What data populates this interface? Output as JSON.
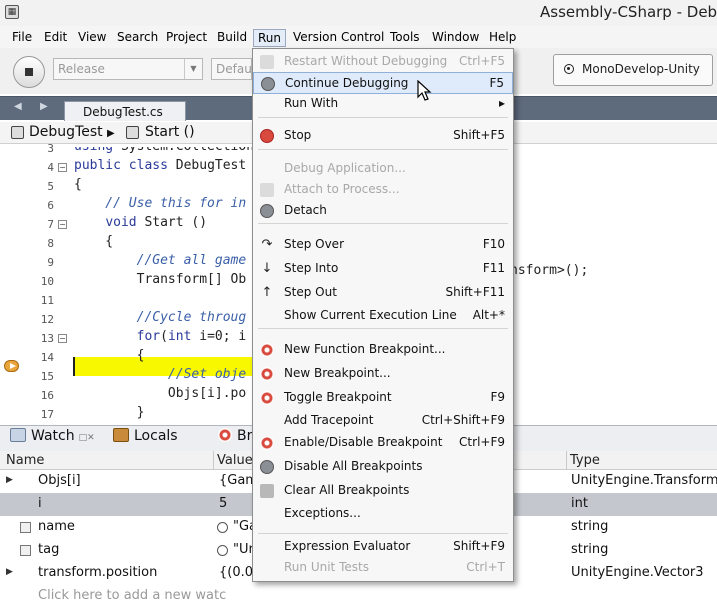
{
  "window": {
    "title": "Assembly-CSharp - Debug"
  },
  "menubar": {
    "items": [
      "File",
      "Edit",
      "View",
      "Search",
      "Project",
      "Build",
      "Run",
      "Version Control",
      "Tools",
      "Window",
      "Help"
    ],
    "active": "Run"
  },
  "toolbar": {
    "config_value": "Release",
    "platform_value": "Default",
    "target_label": "MonoDevelop-Unity"
  },
  "editor": {
    "tab_label": "DebugTest.cs",
    "path_class": "DebugTest",
    "path_method": "Start ()",
    "lines": [
      {
        "n": "3",
        "text": "using System.Collections"
      },
      {
        "n": "4",
        "text": "public class DebugTest"
      },
      {
        "n": "5",
        "text": "{"
      },
      {
        "n": "6",
        "text": "    // Use this for in"
      },
      {
        "n": "7",
        "text": "    void Start ()"
      },
      {
        "n": "8",
        "text": "    {"
      },
      {
        "n": "9",
        "text": "        //Get all game"
      },
      {
        "n": "10",
        "text": "        Transform[] Ob"
      },
      {
        "n": "11",
        "text": ""
      },
      {
        "n": "12",
        "text": "        //Cycle throug"
      },
      {
        "n": "13",
        "text": "        for(int i=0; i"
      },
      {
        "n": "14",
        "text": "        {"
      },
      {
        "n": "15",
        "text": "            //Set obje"
      },
      {
        "n": "16",
        "text": "            Objs[i].po"
      },
      {
        "n": "17",
        "text": "        }"
      },
      {
        "n": "18",
        "text": "    }"
      },
      {
        "n": "19",
        "text": "}"
      }
    ],
    "tail_text": "nsform>();",
    "current_line": "16"
  },
  "pads": {
    "tabs": [
      "Watch",
      "Locals",
      "Br"
    ]
  },
  "watch": {
    "columns": [
      "Name",
      "Value",
      "Type"
    ],
    "rows": [
      {
        "name": "Objs[i]",
        "value": "{Gam",
        "type": "UnityEngine.Transform",
        "expandable": true,
        "selected": false,
        "icon": "none"
      },
      {
        "name": "i",
        "value": "5",
        "type": "int",
        "expandable": false,
        "selected": true,
        "icon": "none"
      },
      {
        "name": "name",
        "value": "\"Ga",
        "type": "string",
        "expandable": false,
        "selected": false,
        "icon": "property"
      },
      {
        "name": "tag",
        "value": "\"Ur",
        "type": "string",
        "expandable": false,
        "selected": false,
        "icon": "property"
      },
      {
        "name": "transform.position",
        "value": "{(0.0",
        "type": "UnityEngine.Vector3",
        "expandable": true,
        "selected": false,
        "icon": "none"
      }
    ],
    "add_placeholder": "Click here to add a new watc"
  },
  "run_menu": {
    "items": [
      {
        "label": "Restart Without Debugging",
        "shortcut": "Ctrl+F5",
        "icon": "restart-icon",
        "disabled": true
      },
      {
        "label": "Continue Debugging",
        "shortcut": "F5",
        "icon": "continue-icon",
        "disabled": false,
        "hover": true
      },
      {
        "label": "Run With",
        "shortcut": "▸",
        "icon": "",
        "disabled": false
      },
      {
        "label": "Stop",
        "shortcut": "Shift+F5",
        "icon": "stop-icon",
        "disabled": false
      },
      {
        "label": "Debug Application...",
        "shortcut": "",
        "icon": "",
        "disabled": true
      },
      {
        "label": "Attach to Process...",
        "shortcut": "",
        "icon": "attach-icon",
        "disabled": true
      },
      {
        "label": "Detach",
        "shortcut": "",
        "icon": "detach-icon",
        "disabled": false
      },
      {
        "label": "Step Over",
        "shortcut": "F10",
        "icon": "step-over-icon",
        "disabled": false
      },
      {
        "label": "Step Into",
        "shortcut": "F11",
        "icon": "step-into-icon",
        "disabled": false
      },
      {
        "label": "Step Out",
        "shortcut": "Shift+F11",
        "icon": "step-out-icon",
        "disabled": false
      },
      {
        "label": "Show Current Execution Line",
        "shortcut": "Alt+*",
        "icon": "",
        "disabled": false
      },
      {
        "label": "New Function Breakpoint...",
        "shortcut": "",
        "icon": "function-breakpoint-icon",
        "disabled": false
      },
      {
        "label": "New Breakpoint...",
        "shortcut": "",
        "icon": "new-breakpoint-icon",
        "disabled": false
      },
      {
        "label": "Toggle Breakpoint",
        "shortcut": "F9",
        "icon": "toggle-breakpoint-icon",
        "disabled": false
      },
      {
        "label": "Add Tracepoint",
        "shortcut": "Ctrl+Shift+F9",
        "icon": "",
        "disabled": false
      },
      {
        "label": "Enable/Disable Breakpoint",
        "shortcut": "Ctrl+F9",
        "icon": "enable-breakpoint-icon",
        "disabled": false
      },
      {
        "label": "Disable All Breakpoints",
        "shortcut": "",
        "icon": "disable-all-breakpoints-icon",
        "disabled": false
      },
      {
        "label": "Clear All Breakpoints",
        "shortcut": "",
        "icon": "eraser-icon",
        "disabled": false
      },
      {
        "label": "Exceptions...",
        "shortcut": "",
        "icon": "",
        "disabled": false
      },
      {
        "label": "Expression Evaluator",
        "shortcut": "Shift+F9",
        "icon": "",
        "disabled": false
      },
      {
        "label": "Run Unit Tests",
        "shortcut": "Ctrl+T",
        "icon": "",
        "disabled": true
      }
    ]
  }
}
